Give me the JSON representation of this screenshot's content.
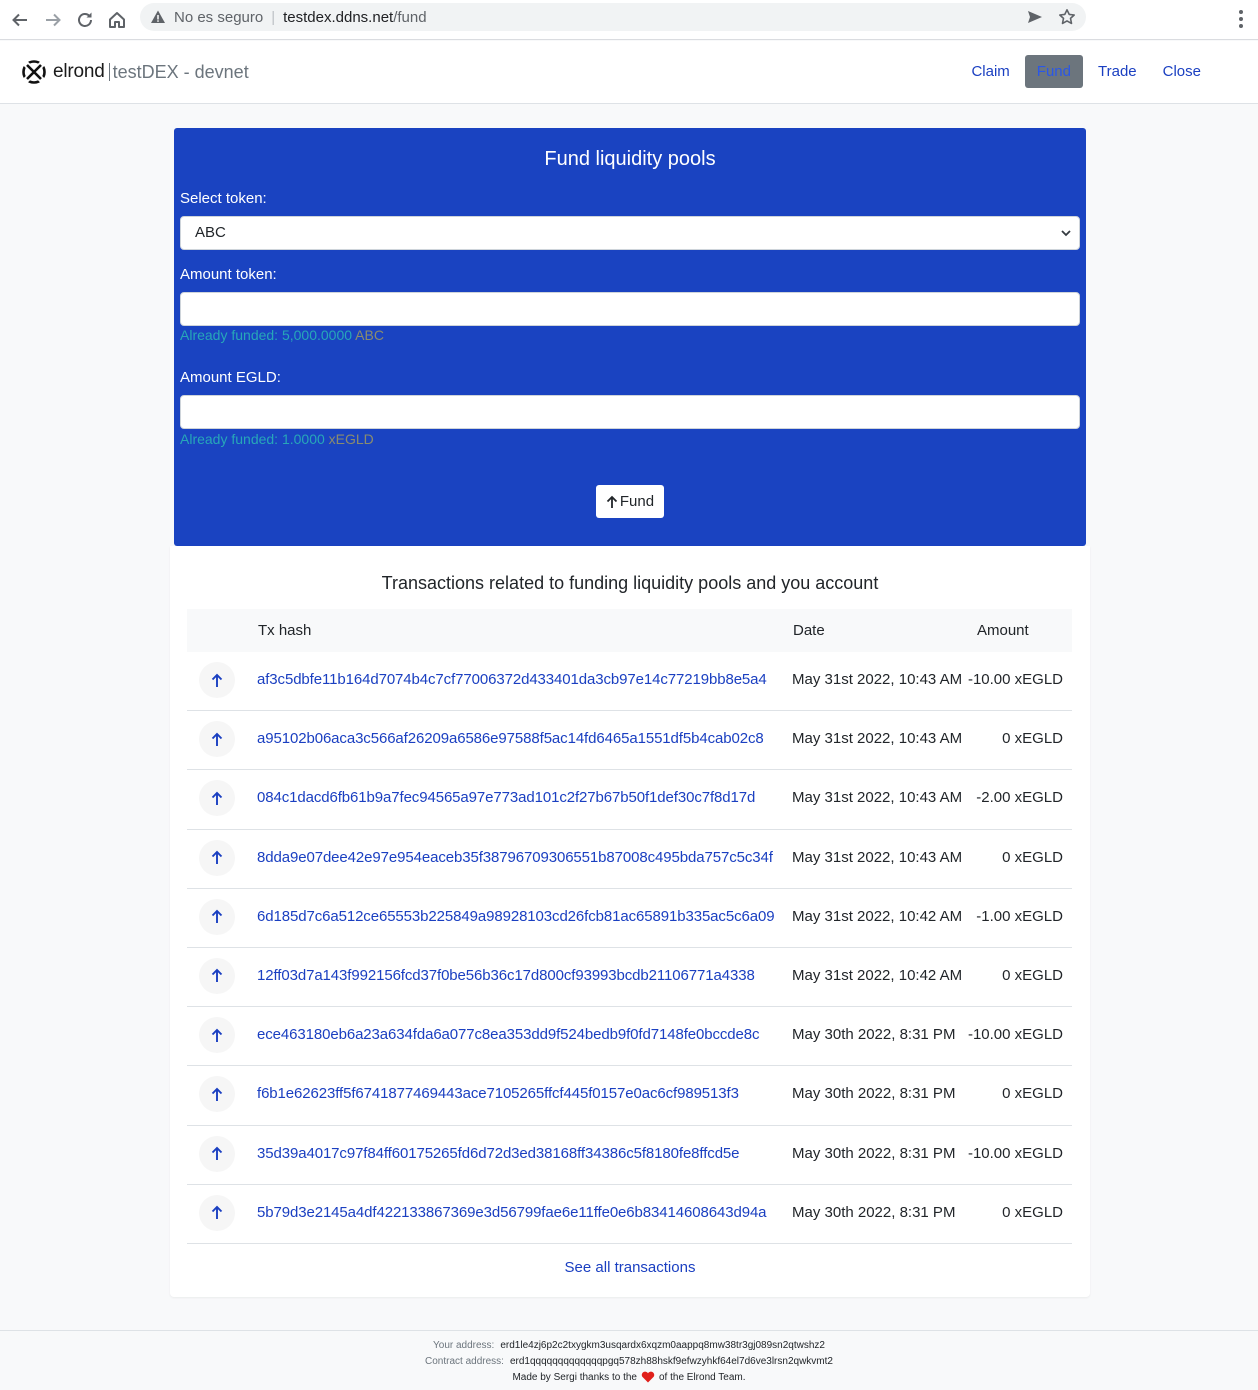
{
  "browser": {
    "security_label": "No es seguro",
    "separator": "|",
    "host": "testdex.ddns.net",
    "path": "/fund"
  },
  "header": {
    "brand": "elrond",
    "app_name": "testDEX - devnet",
    "nav": [
      "Claim",
      "Fund",
      "Trade",
      "Close"
    ],
    "active_nav": "Fund"
  },
  "fund": {
    "title": "Fund liquidity pools",
    "select_label": "Select token:",
    "selected_token": "ABC",
    "amount_token_label": "Amount token:",
    "amount_token_value": "",
    "token_funded_prefix": "Already funded: 5,000.0000",
    "token_funded_unit": "ABC",
    "amount_egld_label": "Amount EGLD:",
    "amount_egld_value": "",
    "egld_funded_prefix": "Already funded: 1.0000",
    "egld_funded_unit": "xEGLD",
    "button_label": "Fund"
  },
  "transactions": {
    "title": "Transactions related to funding liquidity pools and you account",
    "columns": [
      "Tx hash",
      "Date",
      "Amount"
    ],
    "rows": [
      {
        "hash": "af3c5dbfe11b164d7074b4c7cf77006372d433401da3cb97e14c77219bb8e5a4",
        "date": "May 31st 2022, 10:43 AM",
        "amount": "-10.00 xEGLD"
      },
      {
        "hash": "a95102b06aca3c566af26209a6586e97588f5ac14fd6465a1551df5b4cab02c8",
        "date": "May 31st 2022, 10:43 AM",
        "amount": "0 xEGLD"
      },
      {
        "hash": "084c1dacd6fb61b9a7fec94565a97e773ad101c2f27b67b50f1def30c7f8d17d",
        "date": "May 31st 2022, 10:43 AM",
        "amount": "-2.00 xEGLD"
      },
      {
        "hash": "8dda9e07dee42e97e954eaceb35f38796709306551b87008c495bda757c5c34f",
        "date": "May 31st 2022, 10:43 AM",
        "amount": "0 xEGLD"
      },
      {
        "hash": "6d185d7c6a512ce65553b225849a98928103cd26fcb81ac65891b335ac5c6a09",
        "date": "May 31st 2022, 10:42 AM",
        "amount": "-1.00 xEGLD"
      },
      {
        "hash": "12ff03d7a143f992156fcd37f0be56b36c17d800cf93993bcdb21106771a4338",
        "date": "May 31st 2022, 10:42 AM",
        "amount": "0 xEGLD"
      },
      {
        "hash": "ece463180eb6a23a634fda6a077c8ea353dd9f524bedb9f0fd7148fe0bccde8c",
        "date": "May 30th 2022, 8:31 PM",
        "amount": "-10.00 xEGLD"
      },
      {
        "hash": "f6b1e62623ff5f6741877469443ace7105265ffcf445f0157e0ac6cf989513f3",
        "date": "May 30th 2022, 8:31 PM",
        "amount": "0 xEGLD"
      },
      {
        "hash": "35d39a4017c97f84ff60175265fd6d72d3ed38168ff34386c5f8180fe8ffcd5e",
        "date": "May 30th 2022, 8:31 PM",
        "amount": "-10.00 xEGLD"
      },
      {
        "hash": "5b79d3e2145a4df422133867369e3d56799fae6e11ffe0e6b83414608643d94a",
        "date": "May 30th 2022, 8:31 PM",
        "amount": "0 xEGLD"
      }
    ],
    "see_all": "See all transactions"
  },
  "footer": {
    "your_address_label": "Your address:",
    "your_address": "erd1le4zj6p2c2txygkm3usqardx6xqzm0aappq8mw38tr3gj089sn2qtwshz2",
    "contract_address_label": "Contract address:",
    "contract_address": "erd1qqqqqqqqqqqqqpgq578zh88hskf9efwzyhkf64el7d6ve3lrsn2qwkvmt2",
    "made_by_prefix": "Made by Sergi thanks to the",
    "made_by_suffix": "of the Elrond Team."
  },
  "colors": {
    "primary_blue": "#1a43c1",
    "link_blue": "#1a3fc1",
    "funded_teal": "#27a7b8",
    "active_nav_bg": "#6c757d",
    "heart_red": "#e0201b"
  },
  "icons": {
    "back": "arrow-left-icon",
    "forward": "arrow-right-icon",
    "reload": "reload-icon",
    "home": "home-icon",
    "warning": "warning-icon",
    "send": "send-icon",
    "star": "star-icon",
    "menu": "kebab-menu-icon",
    "tx_direction": "arrow-up-icon",
    "heart": "heart-icon"
  }
}
